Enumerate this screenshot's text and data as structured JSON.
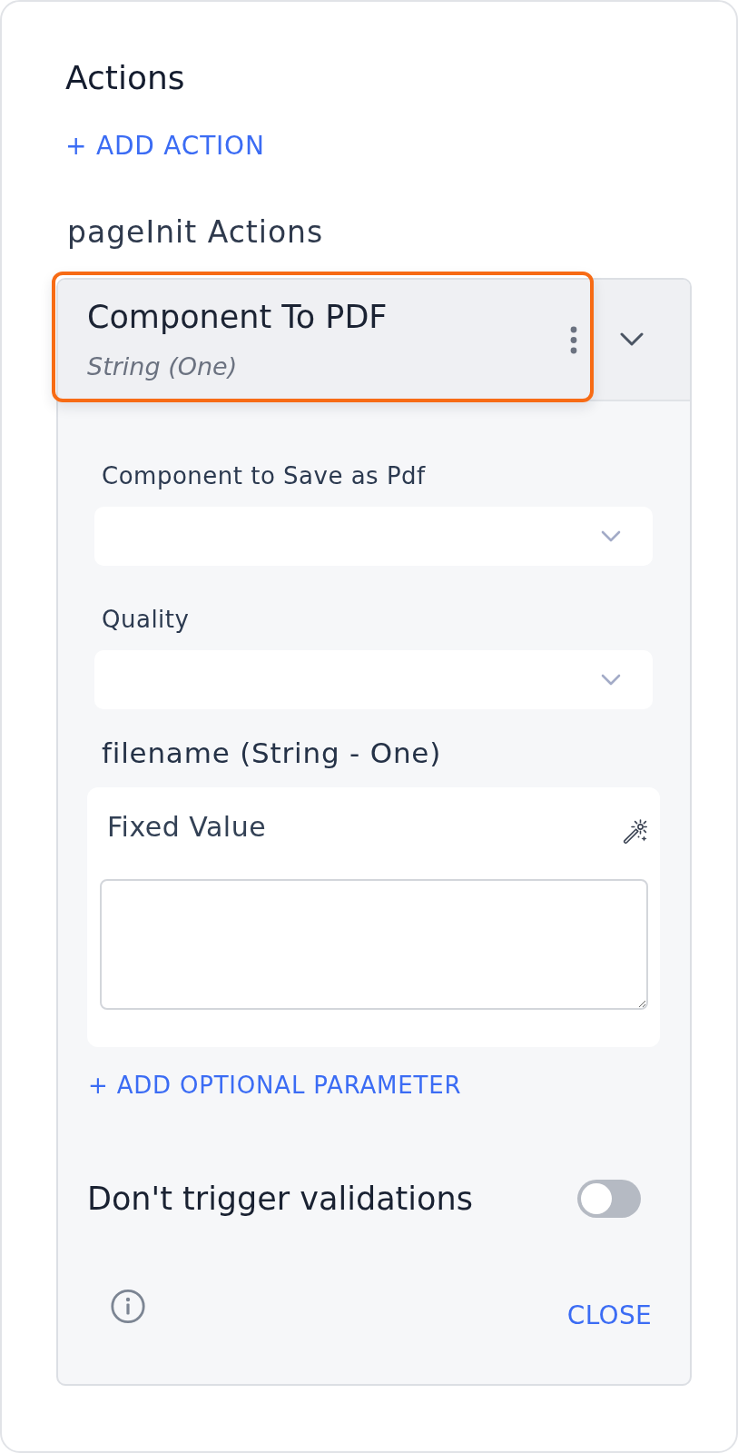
{
  "heading": "Actions",
  "add_action": "+ ADD ACTION",
  "group_heading": "pageInit Actions",
  "action": {
    "title": "Component To PDF",
    "subtitle": "String (One)",
    "highlighted": true,
    "expanded": true,
    "selects": [
      {
        "label": "Component to Save as Pdf"
      },
      {
        "label": "Quality"
      }
    ],
    "parameter": {
      "label": "filename (String - One)",
      "mode": "Fixed Value"
    },
    "add_optional": "+ ADD OPTIONAL PARAMETER",
    "toggle": {
      "label": "Don't trigger validations",
      "on": false
    },
    "close": "CLOSE"
  }
}
